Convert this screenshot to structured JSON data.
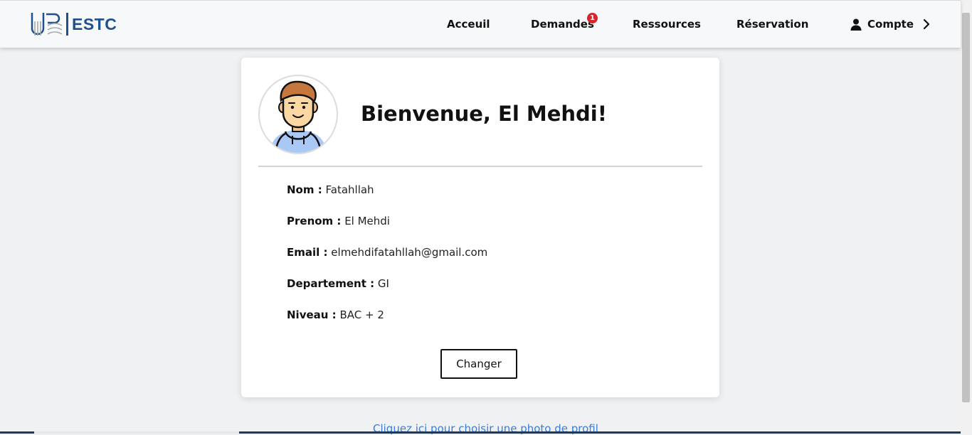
{
  "header": {
    "logo_text": "ESTC",
    "nav": {
      "home": "Acceuil",
      "requests": "Demandes",
      "requests_badge": "1",
      "resources": "Ressources",
      "reservation": "Réservation",
      "account": "Compte"
    }
  },
  "profile": {
    "welcome": "Bienvenue, El Mehdi!",
    "fields": [
      {
        "label": "Nom :",
        "value": "Fatahllah"
      },
      {
        "label": "Prenom :",
        "value": "El Mehdi"
      },
      {
        "label": "Email :",
        "value": "elmehdifatahllah@gmail.com"
      },
      {
        "label": "Departement :",
        "value": "GI"
      },
      {
        "label": "Niveau :",
        "value": "BAC + 2"
      }
    ],
    "change_button": "Changer",
    "photo_link": "Cliquez ici pour choisir une photo de profil"
  },
  "colors": {
    "brand": "#1f4f8f",
    "badge": "#d8242b",
    "link": "#3b7dd8"
  }
}
